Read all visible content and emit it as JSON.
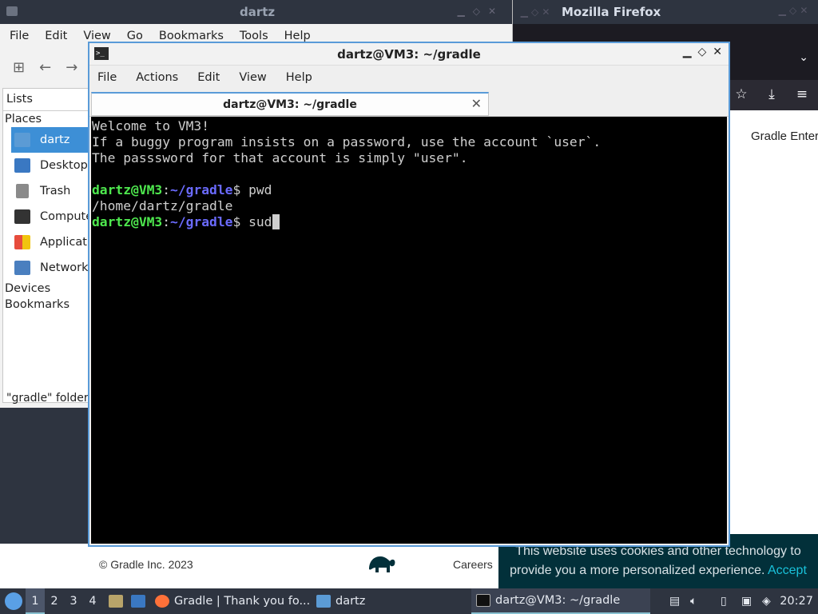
{
  "file_manager": {
    "title": "dartz",
    "menu": [
      "File",
      "Edit",
      "View",
      "Go",
      "Bookmarks",
      "Tools",
      "Help"
    ],
    "sidebar_mode": "Lists",
    "places_header": "Places",
    "places": [
      "dartz",
      "Desktop",
      "Trash",
      "Computer",
      "Applications",
      "Network"
    ],
    "devices_header": "Devices",
    "bookmarks_header": "Bookmarks",
    "status": "\"gradle\" folder"
  },
  "firefox": {
    "title": "Mozilla Firefox",
    "content_heading": "Gradle Enterprise",
    "footer_copyright": "© Gradle Inc. 2023",
    "footer_link": "Careers",
    "cookie_text": "This website uses cookies and other technology to provide you a more personalized experience.",
    "cookie_accept": "Accept"
  },
  "terminal": {
    "title": "dartz@VM3: ~/gradle",
    "menu": [
      "File",
      "Actions",
      "Edit",
      "View",
      "Help"
    ],
    "tab_label": "dartz@VM3: ~/gradle",
    "lines": [
      "Welcome to VM3!",
      "If a buggy program insists on a password, use the account `user`.",
      "The passsword for that account is simply \"user\"."
    ],
    "prompt_user": "dartz@VM3",
    "prompt_path": "~/gradle",
    "cmd1": "pwd",
    "output1": "/home/dartz/gradle",
    "cmd2": "sud"
  },
  "taskbar": {
    "workspaces": [
      "1",
      "2",
      "3",
      "4"
    ],
    "tasks": [
      "Gradle | Thank you fo...",
      "dartz",
      "dartz@VM3: ~/gradle"
    ],
    "clock": "20:27"
  },
  "colors": {
    "prompt_user": "#4ee84e",
    "prompt_path": "#6b6bff",
    "selection": "#3d8fd6",
    "taskbar": "#2e3440"
  }
}
